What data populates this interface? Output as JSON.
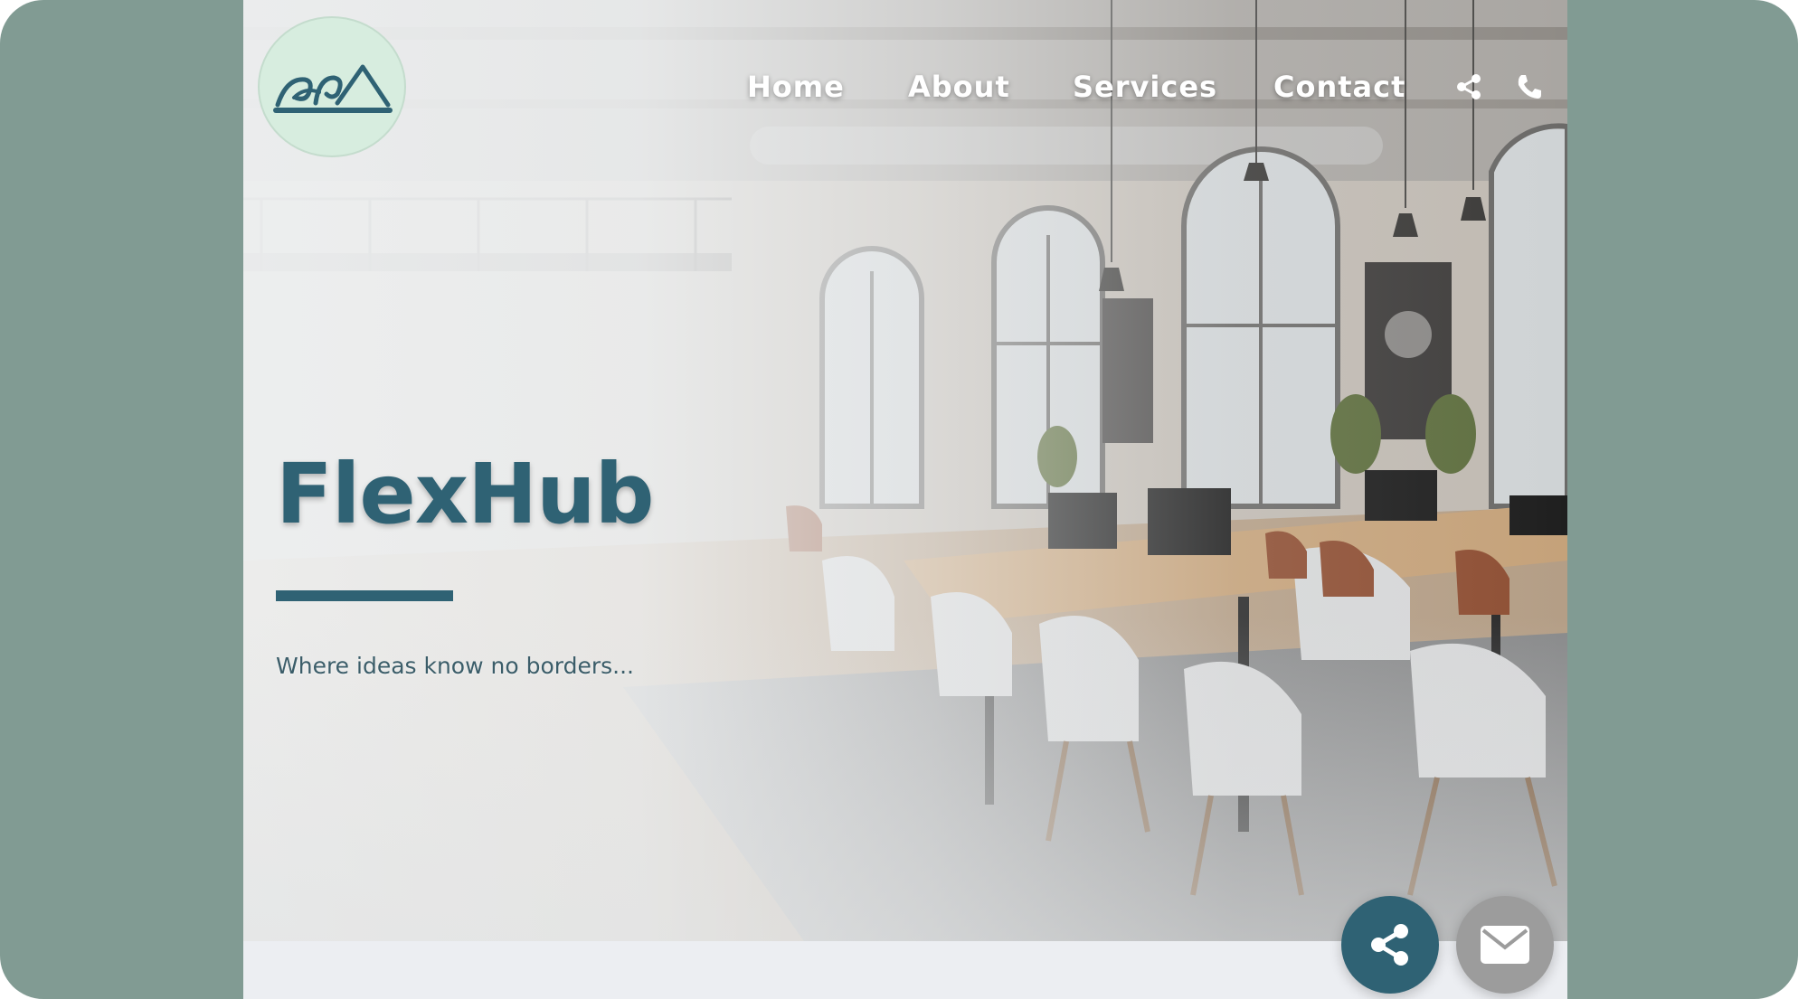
{
  "header": {
    "logo": {
      "icon": "wave-mountain-logo-icon",
      "bg_color": "#d7eddf",
      "ink_color": "#2f6274"
    },
    "nav": [
      {
        "label": "Home"
      },
      {
        "label": "About"
      },
      {
        "label": "Services"
      },
      {
        "label": "Contact"
      }
    ],
    "nav_icons": [
      "share-icon",
      "phone-icon"
    ]
  },
  "hero": {
    "title": "FlexHub",
    "tagline": "Where ideas know no borders...",
    "accent_color": "#2f6274"
  },
  "floating_buttons": [
    {
      "icon": "share-icon",
      "color": "#2f6274"
    },
    {
      "icon": "mail-icon",
      "color": "#9c9c9c"
    }
  ],
  "colors": {
    "frame": "#819b93",
    "page_bottom": "#eceef2",
    "nav_text": "#ffffff"
  }
}
